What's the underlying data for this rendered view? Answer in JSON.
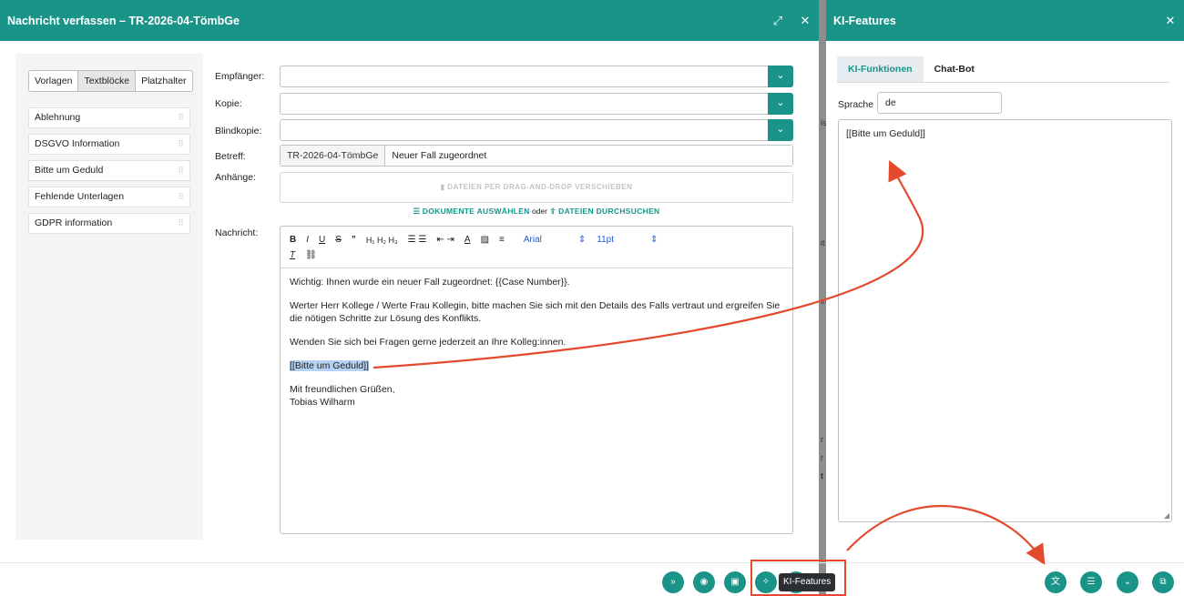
{
  "composer": {
    "title": "Nachricht verfassen – TR-2026-04-TömbGe",
    "expand_icon": "⤢",
    "close_icon": "✕",
    "sidebar": {
      "tabs": [
        "Vorlagen",
        "Textblöcke",
        "Platzhalter"
      ],
      "active_tab": "Textblöcke",
      "blocks": [
        "Ablehnung",
        "DSGVO Information",
        "Bitte um Geduld",
        "Fehlende Unterlagen",
        "GDPR information"
      ]
    },
    "labels": {
      "to": "Empfänger:",
      "cc": "Kopie:",
      "bcc": "Blindkopie:",
      "subject": "Betreff:",
      "attachments": "Anhänge:",
      "message": "Nachricht:"
    },
    "subject_prefix": "TR-2026-04-TömbGe",
    "subject_value": "Neuer Fall zugeordnet",
    "dropzone_text": "DATEIEN PER DRAG-AND-DROP VERSCHIEBEN",
    "select_docs": "DOKUMENTE AUSWÄHLEN",
    "or": "oder",
    "browse_files": "DATEIEN DURCHSUCHEN",
    "toolbar": {
      "font": "Arial",
      "size": "11pt"
    },
    "body": {
      "p1": "Wichtig: Ihnen wurde ein neuer Fall zugeordnet: {{Case Number}}.",
      "p2": "Werter Herr Kollege / Werte Frau Kollegin, bitte machen Sie sich mit den Details des Falls vertraut und ergreifen Sie die nötigen Schritte zur Lösung des Konflikts.",
      "p3": "Wenden Sie sich bei Fragen gerne jederzeit an Ihre Kolleg:innen.",
      "placeholder": "[[Bitte um Geduld]]",
      "closing": "Mit freundlichen Grüßen,",
      "signature": "Tobias Wilharm"
    },
    "tooltip": "KI-Features"
  },
  "ai_panel": {
    "title": "KI-Features",
    "close_icon": "✕",
    "tabs": [
      "KI-Funktionen",
      "Chat-Bot"
    ],
    "active_tab": "KI-Funktionen",
    "language_label": "Sprache",
    "language_value": "de",
    "textarea_value": "[[Bitte um Geduld]]"
  },
  "colors": {
    "teal": "#1a9488",
    "annotation_red": "#e44a2e"
  }
}
